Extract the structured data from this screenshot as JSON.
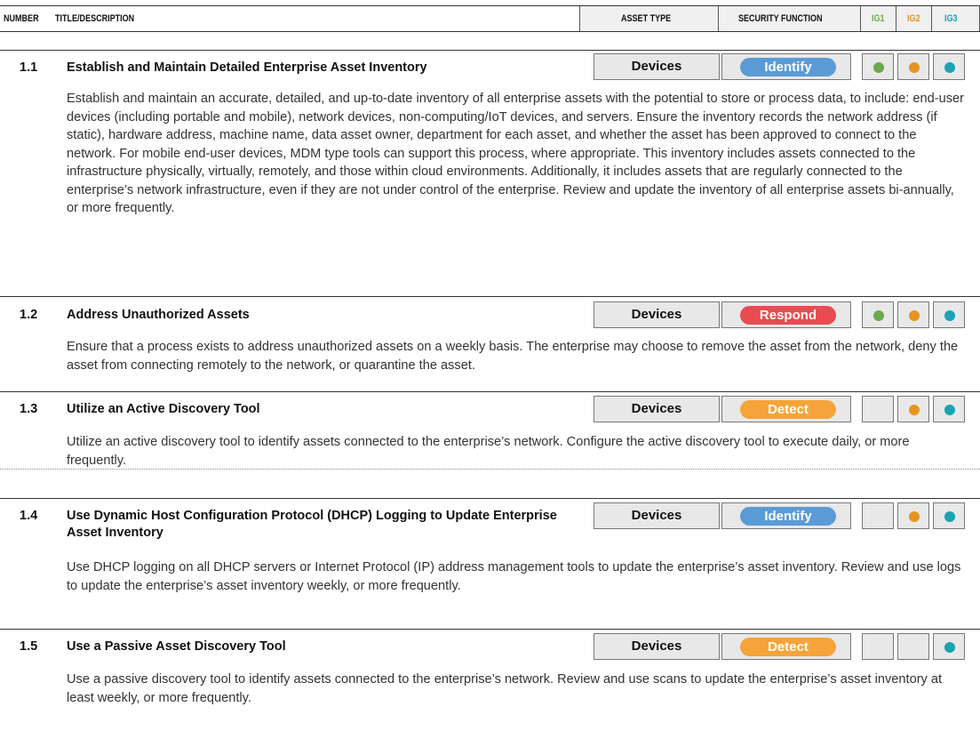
{
  "header": {
    "number": "NUMBER",
    "title": "TITLE/DESCRIPTION",
    "asset_type": "ASSET TYPE",
    "security_function": "SECURITY FUNCTION",
    "ig1": "IG1",
    "ig2": "IG2",
    "ig3": "IG3"
  },
  "colors": {
    "identify": "#5b9bd5",
    "respond": "#e94b50",
    "detect": "#f5a43a",
    "ig1": "#6aaa4a",
    "ig2": "#e5951f",
    "ig3": "#1aa3b3"
  },
  "controls": [
    {
      "number": "1.1",
      "title": "Establish and Maintain Detailed Enterprise Asset Inventory",
      "asset_type": "Devices",
      "function": "Identify",
      "ig1": true,
      "ig2": true,
      "ig3": true,
      "description": "Establish and maintain an accurate, detailed, and up-to-date inventory of all enterprise assets with the potential to store or process data, to include: end-user devices (including portable and mobile), network devices, non-computing/IoT devices, and servers. Ensure the inventory records the network address (if static), hardware address, machine name, data asset owner, department for each asset, and whether the asset has been approved to connect to the network. For mobile end-user devices, MDM type tools can support this process, where appropriate. This inventory includes assets connected to the infrastructure physically, virtually, remotely, and those within cloud environments. Additionally, it includes assets that are regularly connected to the enterprise’s network infrastructure, even if they are not under control of the enterprise. Review and update the inventory of all enterprise assets bi-annually, or more frequently."
    },
    {
      "number": "1.2",
      "title": "Address Unauthorized Assets",
      "asset_type": "Devices",
      "function": "Respond",
      "ig1": true,
      "ig2": true,
      "ig3": true,
      "description": "Ensure that a process exists to address unauthorized assets on a weekly basis. The enterprise may choose to remove the asset from the network, deny the asset from connecting remotely to the network, or quarantine the asset."
    },
    {
      "number": "1.3",
      "title": "Utilize an Active Discovery Tool",
      "asset_type": "Devices",
      "function": "Detect",
      "ig1": false,
      "ig2": true,
      "ig3": true,
      "description": "Utilize an active discovery tool to identify assets connected to the enterprise’s network. Configure the active discovery tool to execute daily, or more frequently."
    },
    {
      "number": "1.4",
      "title": "Use Dynamic Host Configuration Protocol (DHCP) Logging to Update Enterprise Asset Inventory",
      "asset_type": "Devices",
      "function": "Identify",
      "ig1": false,
      "ig2": true,
      "ig3": true,
      "description": "Use DHCP logging on all DHCP servers or Internet Protocol (IP) address management tools to update the enterprise’s asset inventory. Review and use logs to update the enterprise’s asset inventory weekly, or more frequently."
    },
    {
      "number": "1.5",
      "title": "Use a Passive Asset Discovery Tool",
      "asset_type": "Devices",
      "function": "Detect",
      "ig1": false,
      "ig2": false,
      "ig3": true,
      "description": "Use a passive discovery tool to identify assets connected to the enterprise’s network. Review and use scans to update the enterprise’s asset inventory at least weekly, or more frequently."
    }
  ]
}
